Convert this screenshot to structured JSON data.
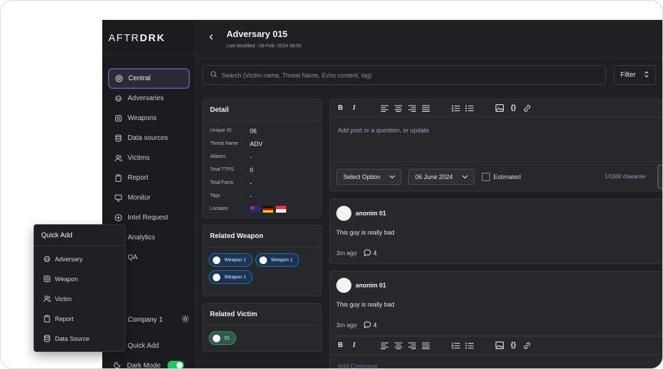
{
  "brand": {
    "logo_thin": "AFTR",
    "logo_bold": "DRK"
  },
  "sidebar": {
    "items": [
      {
        "label": "Central",
        "icon": "grid-icon",
        "active": true
      },
      {
        "label": "Adversaries",
        "icon": "skull-icon"
      },
      {
        "label": "Weapons",
        "icon": "weapon-icon"
      },
      {
        "label": "Data sources",
        "icon": "database-icon"
      },
      {
        "label": "Victims",
        "icon": "users-icon"
      },
      {
        "label": "Report",
        "icon": "clipboard-icon"
      },
      {
        "label": "Monitor",
        "icon": "monitor-icon"
      },
      {
        "label": "Intel Request",
        "icon": "plus-circle-icon"
      },
      {
        "label": "Analytics",
        "icon": "chart-icon"
      },
      {
        "label": "QA",
        "icon": "help-icon"
      }
    ],
    "company": "Company 1",
    "quick_add": "Quick Add",
    "dark_mode": "Dark Mode",
    "dark_mode_on": true
  },
  "header": {
    "title": "Adversary 015",
    "modified": "Last Modified : 06-Feb- 2024 08:00"
  },
  "search": {
    "placeholder": "Search (Victim name, Threat Name, Echo content, tag)"
  },
  "filter": {
    "label": "Filter"
  },
  "detail": {
    "title": "Detail",
    "rows": [
      {
        "key": "Unique ID",
        "value": "06"
      },
      {
        "key": "Threat Name",
        "value": "ADV"
      },
      {
        "key": "Aliases",
        "value": "-"
      },
      {
        "key": "Total TTPS",
        "value": "0"
      },
      {
        "key": "Total Facts",
        "value": "-"
      },
      {
        "key": "Tags",
        "value": "-"
      },
      {
        "key": "Location",
        "value": ""
      }
    ]
  },
  "related_weapon": {
    "title": "Related Weapon",
    "chips": [
      "Weapon 1",
      "Weapon 1",
      "Weapon 1"
    ]
  },
  "related_victim": {
    "title": "Related Victim",
    "chips": [
      "01"
    ]
  },
  "editor": {
    "placeholder": "Add post or a question, or update",
    "select": "Select Option",
    "date": "06 June 2024",
    "estimated": "Estimated",
    "counter": "1/1500 character"
  },
  "posts": [
    {
      "author": "anonim 01",
      "text": "This guy is really bad",
      "time": "3m ago",
      "comments": "4"
    },
    {
      "author": "anonim 01",
      "text": "This guy is really bad",
      "time": "3m ago",
      "comments": "4"
    }
  ],
  "editor2": {
    "placeholder": "Add Comment"
  },
  "quick_add": {
    "title": "Quick Add",
    "items": [
      {
        "label": "Adversary",
        "icon": "skull-icon"
      },
      {
        "label": "Weapon",
        "icon": "weapon-icon"
      },
      {
        "label": "Victim",
        "icon": "users-icon"
      },
      {
        "label": "Report",
        "icon": "clipboard-icon"
      },
      {
        "label": "Data Source",
        "icon": "database-icon"
      }
    ]
  },
  "colors": {
    "accent": "#7a63b8",
    "chip_blue": "#1a3552",
    "chip_green": "#2d5c4a",
    "toggle": "#22c55e"
  }
}
